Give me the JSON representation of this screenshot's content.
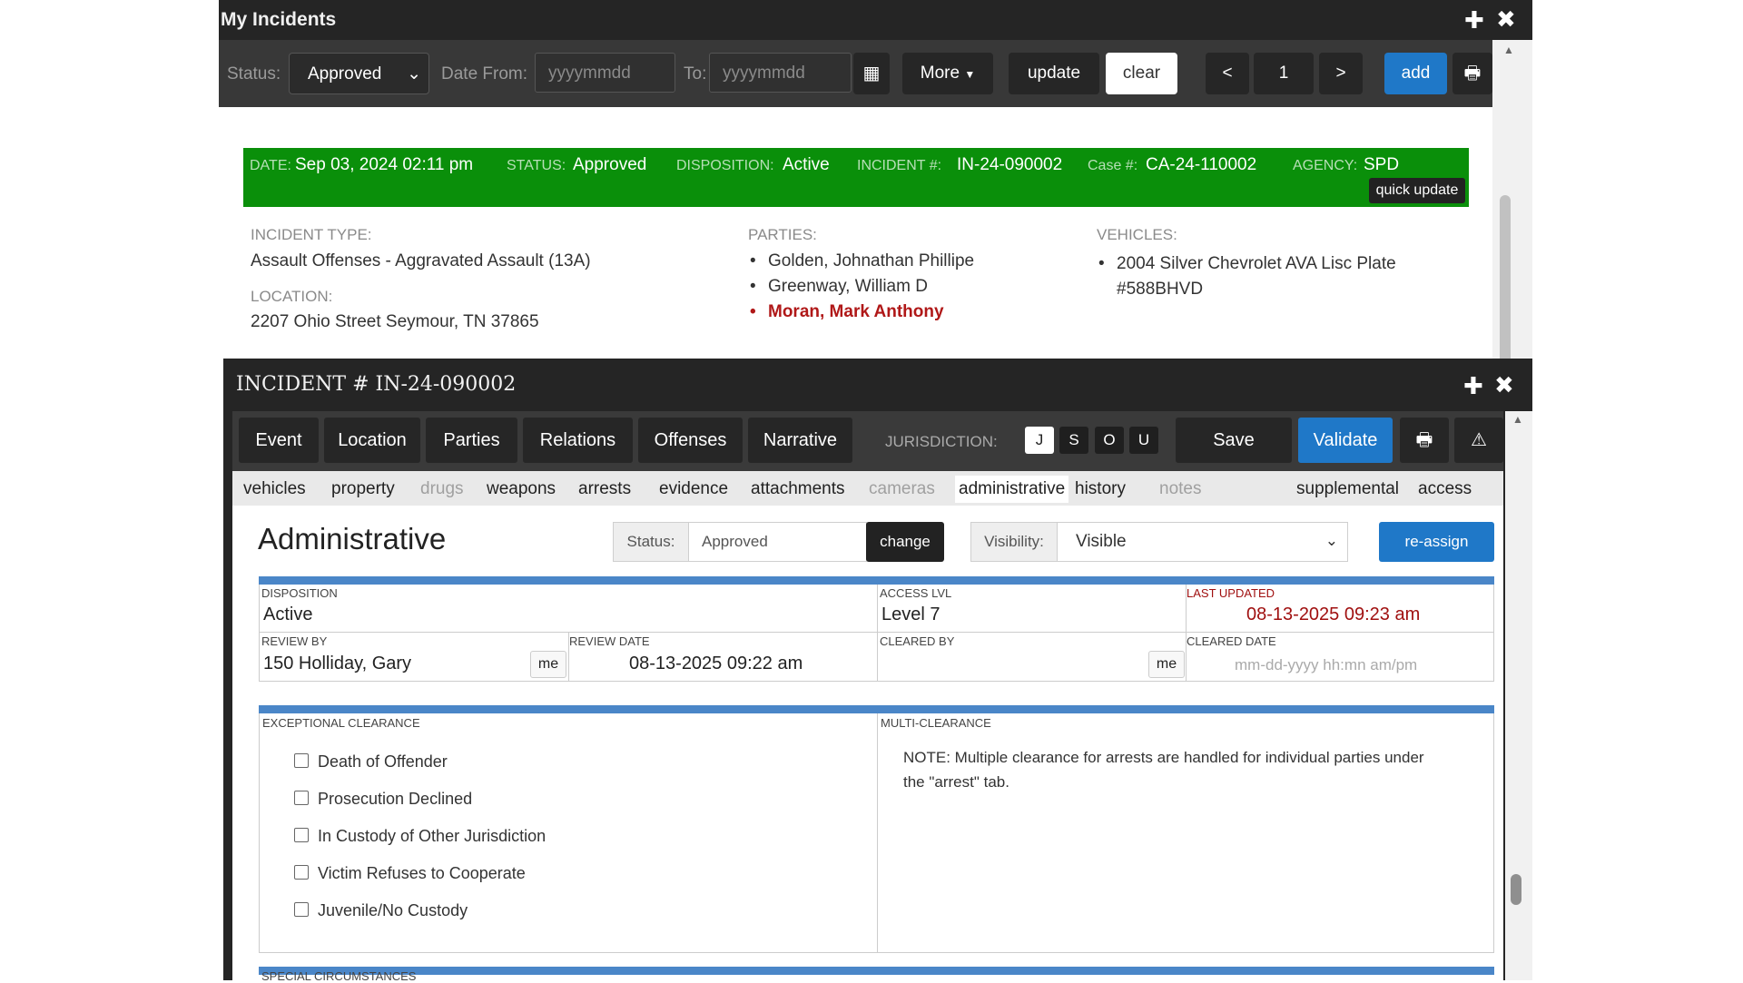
{
  "win1": {
    "title": "My Incidents",
    "toolbar": {
      "status_label": "Status:",
      "status_value": "Approved",
      "date_from_label": "Date From:",
      "date_from_placeholder": "yyyymmdd",
      "to_label": "To:",
      "to_placeholder": "yyyymmdd",
      "more_label": "More",
      "update_label": "update",
      "clear_label": "clear",
      "prev_label": "<",
      "page": "1",
      "next_label": ">",
      "add_label": "add"
    },
    "banner": {
      "date_label": "DATE:",
      "date": "Sep 03, 2024 02:11 pm",
      "status_label": "STATUS:",
      "status": "Approved",
      "disposition_label": "DISPOSITION:",
      "disposition": "Active",
      "incident_label": "INCIDENT #:",
      "incident": "IN-24-090002",
      "case_label": "Case #:",
      "case": "CA-24-110002",
      "agency_label": "AGENCY:",
      "agency": "SPD",
      "quick_update": "quick update",
      "color": "#0a8f0a"
    },
    "incident_type_label": "INCIDENT TYPE:",
    "incident_type": "Assault Offenses - Aggravated Assault (13A)",
    "location_label": "LOCATION:",
    "location": "2207 Ohio Street Seymour, TN 37865",
    "parties_label": "PARTIES:",
    "parties": [
      "Golden, Johnathan Phillipe",
      "Greenway, William D",
      "Moran, Mark Anthony"
    ],
    "vehicles_label": "VEHICLES:",
    "vehicles": [
      "2004 Silver Chevrolet AVA Lisc Plate #588BHVD"
    ]
  },
  "win2": {
    "title": "INCIDENT # IN-24-090002",
    "tabs": [
      "Event",
      "Location",
      "Parties",
      "Relations",
      "Offenses",
      "Narrative"
    ],
    "jurisdiction_label": "JURISDICTION:",
    "jurisdiction": [
      "J",
      "S",
      "O",
      "U"
    ],
    "save_label": "Save",
    "validate_label": "Validate",
    "subnav": [
      {
        "label": "vehicles",
        "state": "normal"
      },
      {
        "label": "property",
        "state": "normal"
      },
      {
        "label": "drugs",
        "state": "disabled"
      },
      {
        "label": "weapons",
        "state": "normal"
      },
      {
        "label": "arrests",
        "state": "normal"
      },
      {
        "label": "evidence",
        "state": "normal"
      },
      {
        "label": "attachments",
        "state": "normal"
      },
      {
        "label": "cameras",
        "state": "disabled"
      },
      {
        "label": "administrative",
        "state": "active"
      },
      {
        "label": "history",
        "state": "normal"
      },
      {
        "label": "notes",
        "state": "disabled"
      },
      {
        "label": "supplemental",
        "state": "normal"
      },
      {
        "label": "access",
        "state": "normal"
      }
    ],
    "admin": {
      "title": "Administrative",
      "status_label": "Status:",
      "status_value": "Approved",
      "change_label": "change",
      "visibility_label": "Visibility:",
      "visibility_value": "Visible",
      "reassign_label": "re-assign",
      "disposition_label": "DISPOSITION",
      "disposition": "Active",
      "access_label": "ACCESS LVL",
      "access": "Level 7",
      "last_updated_label": "LAST UPDATED",
      "last_updated": "08-13-2025 09:23 am",
      "review_by_label": "REVIEW BY",
      "review_by": "150 Holliday, Gary",
      "me_label": "me",
      "review_date_label": "REVIEW DATE",
      "review_date": "08-13-2025 09:22 am",
      "cleared_by_label": "CLEARED BY",
      "cleared_date_label": "CLEARED DATE",
      "cleared_date_placeholder": "mm-dd-yyyy hh:mn am/pm",
      "exceptional_label": "EXCEPTIONAL CLEARANCE",
      "exceptional_options": [
        "Death of Offender",
        "Prosecution Declined",
        "In Custody of Other Jurisdiction",
        "Victim Refuses to Cooperate",
        "Juvenile/No Custody"
      ],
      "multi_label": "MULTI-CLEARANCE",
      "multi_note": "NOTE: Multiple clearance for arrests are handled for individual parties under the \"arrest\" tab.",
      "special_label": "SPECIAL CIRCUMSTANCES",
      "last_updated_color": "#a01010",
      "accent_blue": "#1f78c8"
    }
  }
}
